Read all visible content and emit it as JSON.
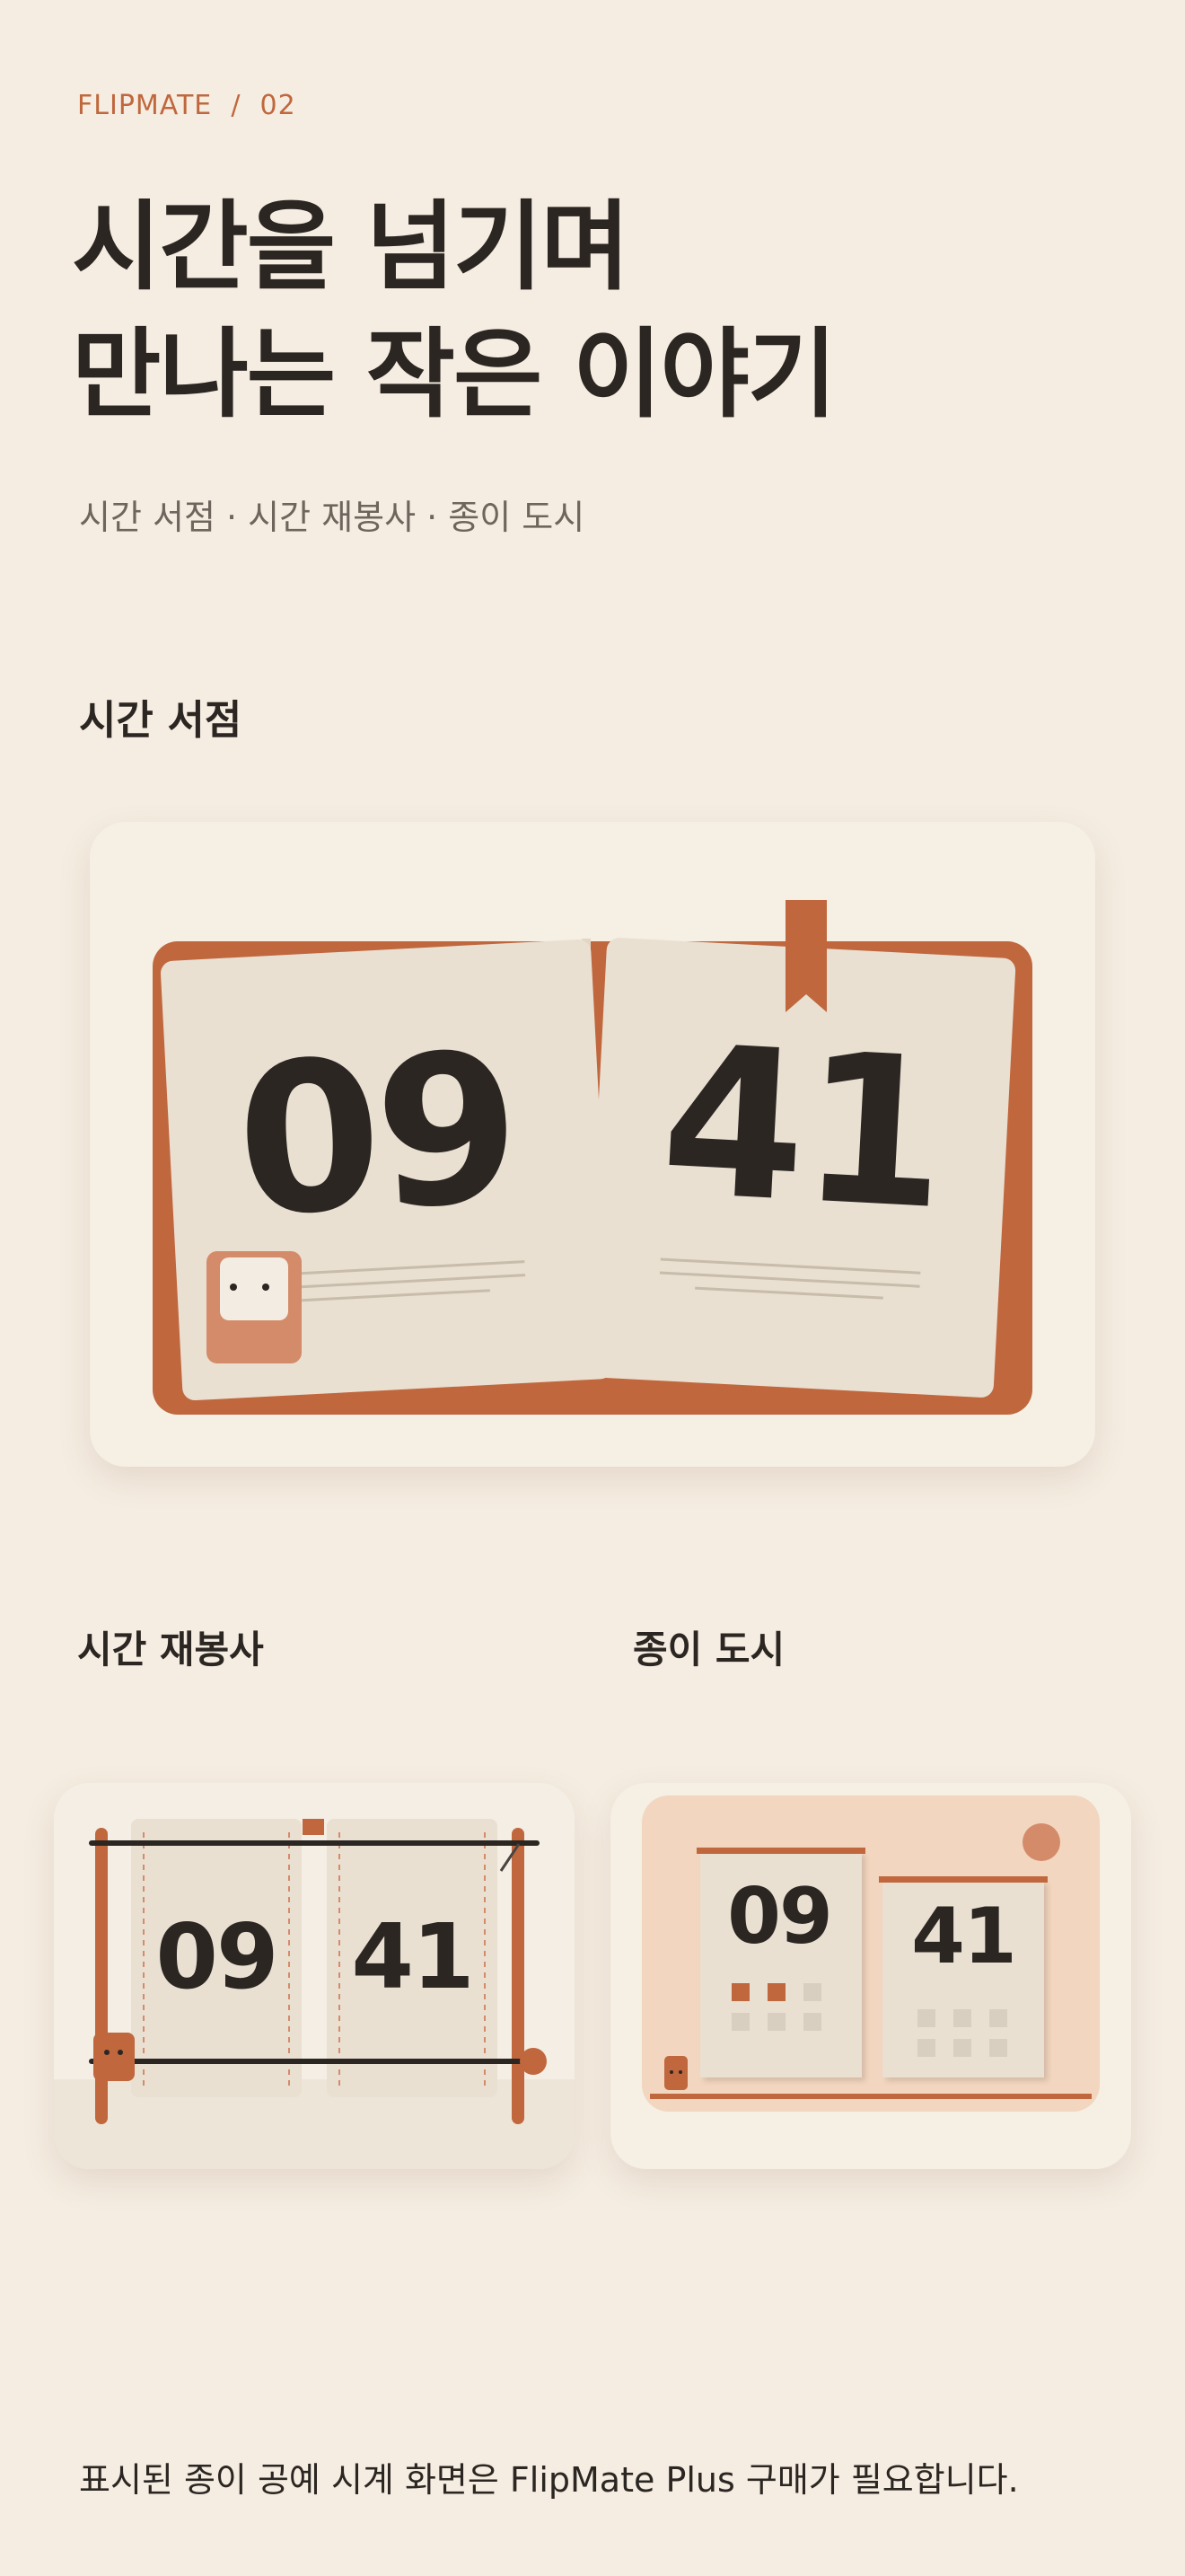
{
  "header": {
    "eyebrow": "FLIPMATE  /  02",
    "headline_line1": "시간을 넘기며",
    "headline_line2": "만나는 작은 이야기",
    "subtitle": "시간 서점 · 시간 재봉사 · 종이 도시"
  },
  "themes": [
    {
      "title": "시간 서점",
      "hour": "09",
      "minute": "41"
    },
    {
      "title": "시간 재봉사",
      "hour": "09",
      "minute": "41"
    },
    {
      "title": "종이 도시",
      "hour": "09",
      "minute": "41"
    }
  ],
  "footer": {
    "note": "표시된 종이 공예 시계 화면은 FlipMate Plus 구매가 필요합니다."
  },
  "colors": {
    "background": "#f5ede2",
    "accent": "#c0673d",
    "card": "#f5efe4",
    "paper": "#e9e0d2",
    "ink": "#2b2622"
  }
}
